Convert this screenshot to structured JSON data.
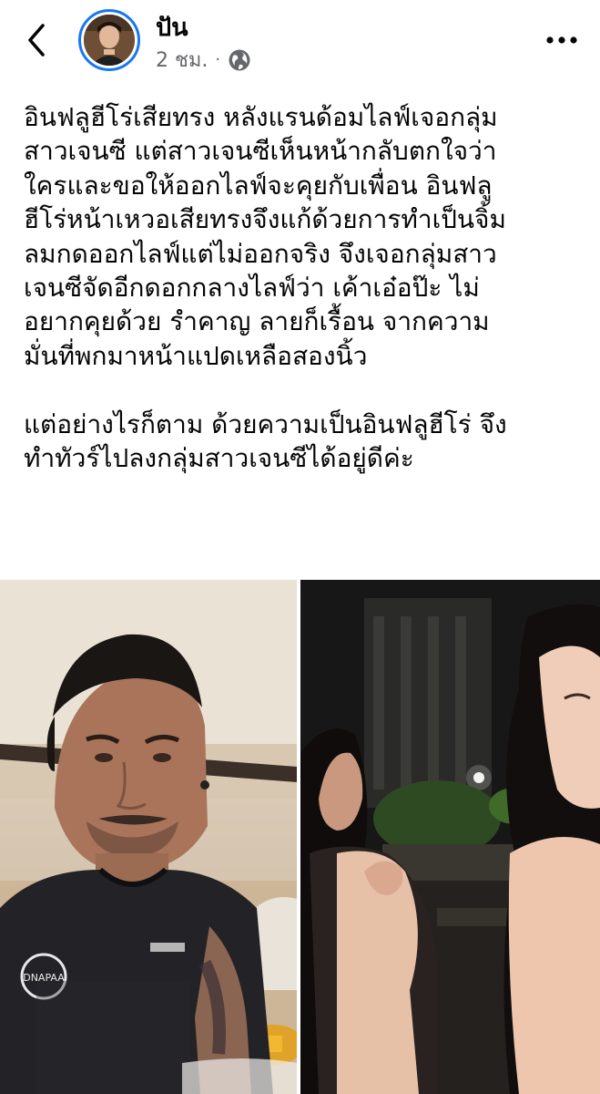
{
  "header": {
    "author": "ปัน",
    "time": "2 ชม.",
    "separator": "·",
    "back_icon": "chevron-left-icon",
    "privacy_icon": "globe-icon",
    "more_icon": "more-horizontal-icon"
  },
  "post": {
    "text": "อินฟลูฮีโร่เสียทรง หลังแรนด้อมไลฟ์เจอกลุ่ม\nสาวเจนซี แต่สาวเจนซีเห็นหน้ากลับตกใจว่า\nใครและขอให้ออกไลฟ์จะคุยกับเพื่อน อินฟลู\nฮีโร่หน้าเหวอเสียทรงจึงแก้ด้วยการทำเป็นจิ้ม\nลมกดออกไลฟ์แต่ไม่ออกจริง จึงเจอกลุ่มสาว\nเจนซีจัดอีกดอกกลางไลฟ์ว่า เค้าเอ๋อป๊ะ ไม่\nอยากคุยด้วย รำคาญ ลายก็เรื้อน จากความ\nมั่นที่พกมาหน้าแปดเหลือสองนิ้ว\n\nแต่อย่างไรก็ตาม ด้วยความเป็นอินฟลูฮีโร่ จึง\nทำทัวร์ไปลงกลุ่มสาวเจนซีได้อยู่ดีค่ะ"
  },
  "media": {
    "left_shirt_text": "DNAPAA",
    "colors": {
      "accent": "#1877f2",
      "meta_gray": "#65676b"
    }
  }
}
